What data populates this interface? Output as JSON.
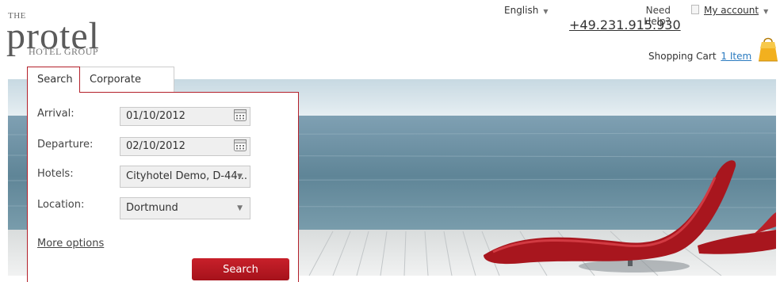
{
  "logo": {
    "the": "THE",
    "word": "protel",
    "group": "HOTEL GROUP"
  },
  "header": {
    "language": "English",
    "help_label": "Need Help?",
    "phone": "+49.231.915.930",
    "account_label": "My account",
    "cart_label": "Shopping Cart",
    "cart_count": "1 Item"
  },
  "tabs": [
    {
      "label": "Search"
    },
    {
      "label": "Corporate"
    }
  ],
  "form": {
    "arrival_label": "Arrival:",
    "arrival_value": "01/10/2012",
    "departure_label": "Departure:",
    "departure_value": "02/10/2012",
    "hotels_label": "Hotels:",
    "hotels_value": "Cityhotel Demo, D-44...",
    "location_label": "Location:",
    "location_value": "Dortmund",
    "more_options": "More options",
    "search_button": "Search"
  },
  "colors": {
    "accent": "#b3202a",
    "link": "#2b7bc0"
  },
  "icons": [
    "calendar-icon",
    "dropdown-arrow-icon",
    "shopping-bag-icon",
    "account-icon"
  ]
}
